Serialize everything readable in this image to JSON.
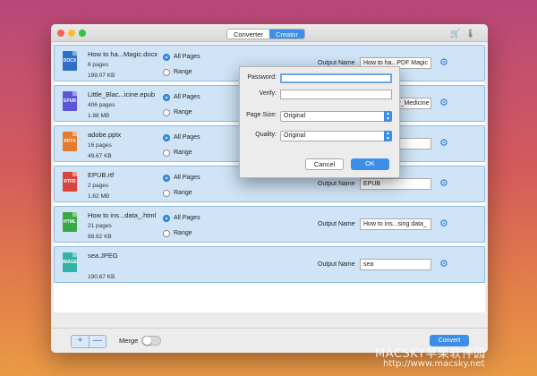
{
  "window": {
    "lights": [
      {
        "name": "close",
        "color": "#ff5f57"
      },
      {
        "name": "minimize",
        "color": "#febc2e"
      },
      {
        "name": "zoom",
        "color": "#28c840"
      }
    ],
    "tabs": [
      {
        "label": "Converter",
        "active": false
      },
      {
        "label": "Creator",
        "active": true
      }
    ],
    "toolbar_icons": [
      "cart-icon",
      "thermometer-icon"
    ]
  },
  "files": [
    {
      "name": "How to ha...Magic.docx",
      "pages": "6 pages",
      "size": "199.07 KB",
      "icon_text": "DOCX",
      "icon_color": "#2f6fc9",
      "all_pages": "All Pages",
      "range": "Range",
      "output_label": "Output Name",
      "output_name": "How to ha...PDF Magic"
    },
    {
      "name": "Little_Blac...icine.epub",
      "pages": "406 pages",
      "size": "1.98 MB",
      "icon_text": "EPUB",
      "icon_color": "#5b57d6",
      "all_pages": "All Pages",
      "range": "Range",
      "output_label": "Output Name",
      "output_name": "Little_Blac...y_Medicine"
    },
    {
      "name": "adobe.pptx",
      "pages": "16 pages",
      "size": "49.67 KB",
      "icon_text": "PPTX",
      "icon_color": "#e67a2e",
      "all_pages": "All Pages",
      "range": "Range",
      "output_label": "Output Name",
      "output_name": "adobe"
    },
    {
      "name": "EPUB.rtf",
      "pages": "2 pages",
      "size": "1.62 MB",
      "icon_text": "RTFD",
      "icon_color": "#d9443d",
      "all_pages": "All Pages",
      "range": "Range",
      "output_label": "Output Name",
      "output_name": "EPUB"
    },
    {
      "name": "How to ins...data_.html",
      "pages": "21 pages",
      "size": "88.82 KB",
      "icon_text": "HTML",
      "icon_color": "#3aa845",
      "all_pages": "All Pages",
      "range": "Range",
      "output_label": "Output Name",
      "output_name": "How to ins...sing data_"
    },
    {
      "name": "sea.JPEG",
      "pages": "",
      "size": "190.67 KB",
      "icon_text": "IMAGE",
      "icon_color": "#33b3a6",
      "all_pages": "",
      "range": "",
      "output_label": "Output Name",
      "output_name": "sea"
    }
  ],
  "dialog": {
    "password_label": "Password:",
    "verify_label": "Verify:",
    "page_size_label": "Page Size:",
    "page_size_value": "Original",
    "quality_label": "Quality:",
    "quality_value": "Original",
    "cancel_label": "Cancel",
    "ok_label": "OK"
  },
  "bottom": {
    "add_label": "+",
    "remove_label": "—",
    "merge_label": "Merge",
    "merge_on": false,
    "convert_label": "Convert"
  },
  "watermark": {
    "brand": "MACSKY苹果软件园",
    "url": "http://www.macsky.net"
  },
  "colors": {
    "accent": "#3c8ee8",
    "row_bg": "#cfe4f7"
  }
}
